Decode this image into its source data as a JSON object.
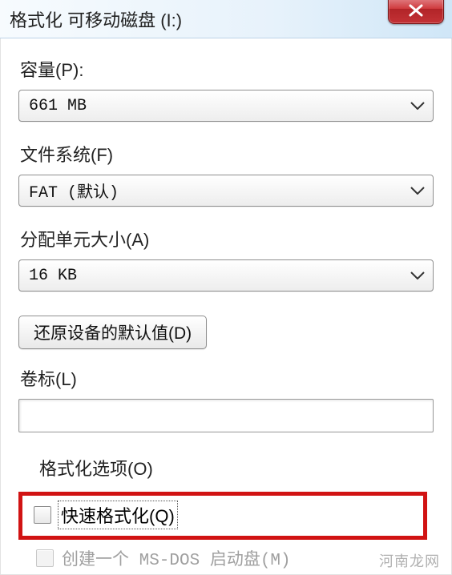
{
  "title": "格式化 可移动磁盘 (I:)",
  "closeIcon": "close-x",
  "capacity": {
    "label": "容量(P):",
    "value": "661 MB"
  },
  "filesystem": {
    "label": "文件系统(F)",
    "value": "FAT (默认)"
  },
  "allocation": {
    "label": "分配单元大小(A)",
    "value": "16 KB"
  },
  "restore": {
    "label": "还原设备的默认值(D)"
  },
  "volume": {
    "label": "卷标(L)",
    "value": ""
  },
  "options": {
    "groupLabel": "格式化选项(O)",
    "quickFormat": {
      "label": "快速格式化(Q)",
      "checked": false
    },
    "msdos": {
      "label": "创建一个 MS-DOS 启动盘(M)",
      "checked": false,
      "disabled": true
    }
  },
  "watermark": "河南龙网"
}
